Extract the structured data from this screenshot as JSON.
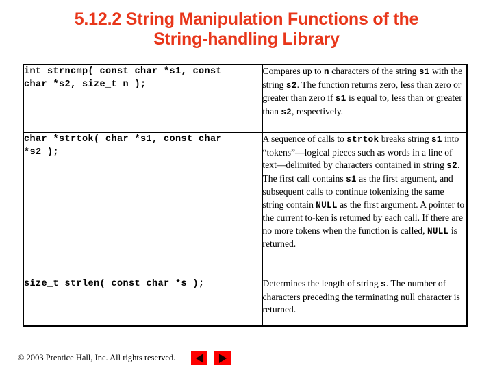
{
  "slide": {
    "title_line1": "5.12.2 String Manipulation Functions of the",
    "title_line2": "String-handling Library",
    "title_color": "#e8361a"
  },
  "table": {
    "rows": [
      {
        "prototype": "int strncmp( const char *s1, const\nchar *s2, size_t n );",
        "description_parts": [
          {
            "text": " Compares up to ",
            "code": false
          },
          {
            "text": "n",
            "code": true
          },
          {
            "text": " characters of the string ",
            "code": false
          },
          {
            "text": "s1",
            "code": true
          },
          {
            "text": " with the string ",
            "code": false
          },
          {
            "text": "s2",
            "code": true
          },
          {
            "text": ". The function returns zero, less than zero or greater than zero if ",
            "code": false
          },
          {
            "text": "s1",
            "code": true
          },
          {
            "text": " is equal to, less than or greater than ",
            "code": false
          },
          {
            "text": "s2",
            "code": true
          },
          {
            "text": ", respectively.",
            "code": false
          }
        ]
      },
      {
        "prototype": "char *strtok( char *s1, const char\n*s2 );",
        "description_parts": [
          {
            "text": " A sequence of calls to ",
            "code": false
          },
          {
            "text": "strtok",
            "code": true
          },
          {
            "text": " breaks string ",
            "code": false
          },
          {
            "text": "s1",
            "code": true
          },
          {
            "text": " into “tokens”—logical pieces such as words in a line of text—delimited by characters contained in string ",
            "code": false
          },
          {
            "text": "s2",
            "code": true
          },
          {
            "text": ". The first call contains ",
            "code": false
          },
          {
            "text": "s1",
            "code": true
          },
          {
            "text": " as the first argument, and subsequent calls to continue tokenizing the same string contain ",
            "code": false
          },
          {
            "text": "NULL",
            "code": true
          },
          {
            "text": " as the first argument. A pointer to the current to-ken is returned by each call. If there are no more tokens when the function is called, ",
            "code": false
          },
          {
            "text": "NULL",
            "code": true
          },
          {
            "text": " is returned.",
            "code": false
          }
        ]
      },
      {
        "prototype": "size_t strlen( const char *s );",
        "description_parts": [
          {
            "text": " Determines the length of string ",
            "code": false
          },
          {
            "text": "s",
            "code": true
          },
          {
            "text": ". The number of characters preceding the terminating null character is returned.",
            "code": false
          }
        ]
      }
    ]
  },
  "footer": {
    "copyright": "© 2003 Prentice Hall, Inc.  All rights reserved.",
    "prev_label": "previous-slide",
    "next_label": "next-slide",
    "button_color": "#fe0000"
  }
}
